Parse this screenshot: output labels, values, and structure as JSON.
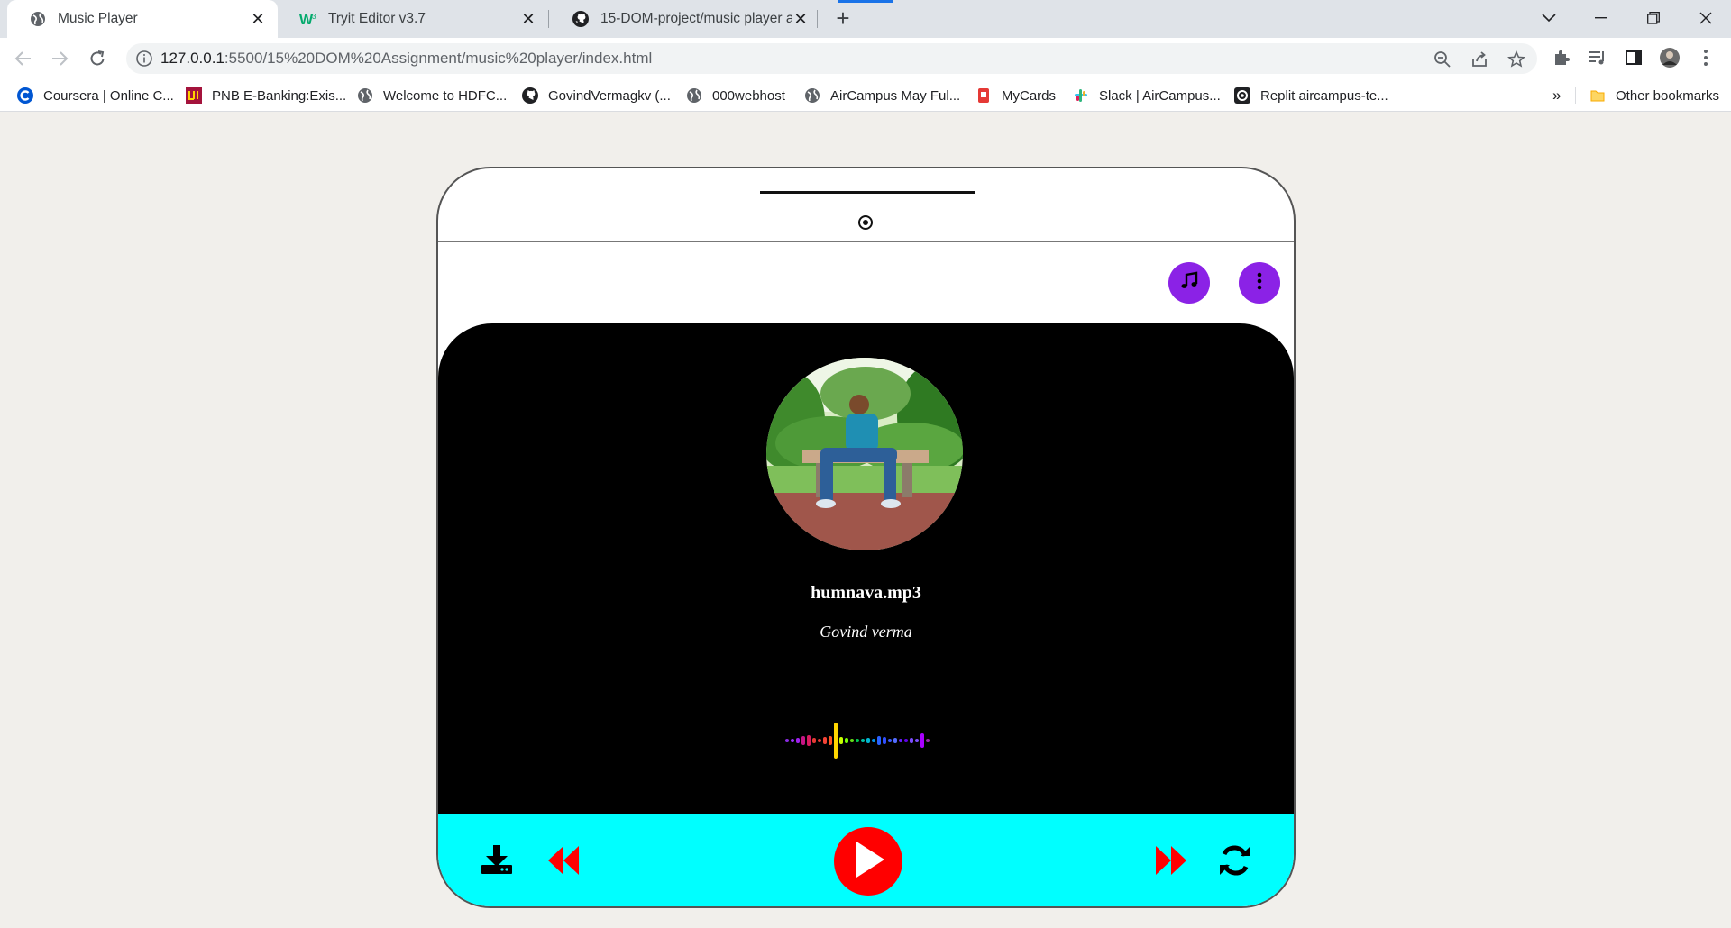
{
  "browser": {
    "tabs": [
      {
        "title": "Music Player"
      },
      {
        "title": "Tryit Editor v3.7"
      },
      {
        "title": "15-DOM-project/music player at"
      }
    ],
    "url_host": "127.0.0.1",
    "url_path": ":5500/15%20DOM%20Assignment/music%20player/index.html",
    "bookmarks": [
      "Coursera | Online C...",
      "PNB E-Banking:Exis...",
      "Welcome to HDFC...",
      "GovindVermagkv (...",
      "000webhost",
      "AirCampus May Ful...",
      "MyCards",
      "Slack | AirCampus...",
      "Replit aircampus-te..."
    ],
    "bookmarks_overflow": "»",
    "other_bookmarks": "Other bookmarks"
  },
  "player": {
    "song_title": "humnava.mp3",
    "artist": "Govind verma",
    "colors": {
      "accent_purple": "#8b22e6",
      "control_bar": "#00ffff",
      "control_red": "#ff0000",
      "screen": "#000000"
    },
    "icons": [
      "music-note-icon",
      "kebab-menu-icon",
      "download-icon",
      "previous-icon",
      "play-icon",
      "next-icon",
      "repeat-icon"
    ]
  }
}
